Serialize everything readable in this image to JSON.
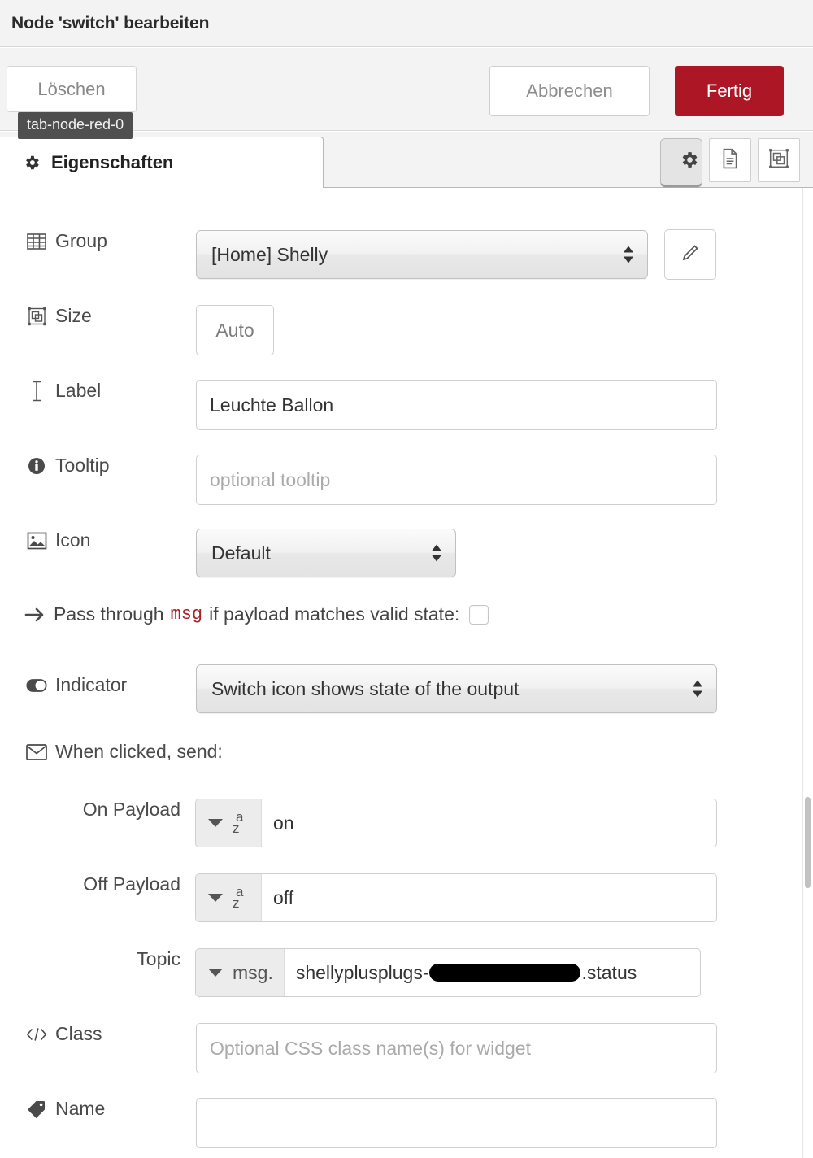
{
  "dialog": {
    "title": "Node 'switch' bearbeiten",
    "tooltip": "tab-node-red-0",
    "buttons": {
      "delete": "Löschen",
      "cancel": "Abbrechen",
      "done": "Fertig"
    },
    "accent_color": "#ad1625"
  },
  "tabs": {
    "active_label": "Eigenschaften",
    "icons": [
      {
        "name": "gear-icon",
        "selected": true
      },
      {
        "name": "document-icon",
        "selected": false
      },
      {
        "name": "appearance-icon",
        "selected": false
      }
    ]
  },
  "form": {
    "group": {
      "label": "Group",
      "icon": "table-icon",
      "value": "[Home] Shelly",
      "edit_button_icon": "pencil-icon"
    },
    "size": {
      "label": "Size",
      "icon": "object-group-icon",
      "value": "Auto"
    },
    "label_field": {
      "label": "Label",
      "icon": "text-cursor-icon",
      "value": "Leuchte Ballon"
    },
    "tooltip_field": {
      "label": "Tooltip",
      "icon": "info-circle-icon",
      "value": "",
      "placeholder": "optional tooltip"
    },
    "icon_field": {
      "label": "Icon",
      "icon": "image-icon",
      "value": "Default"
    },
    "passthrough": {
      "icon": "arrow-right-icon",
      "text_before": "Pass through",
      "code": "msg",
      "text_after": "if payload matches valid state:",
      "checked": false
    },
    "indicator": {
      "label": "Indicator",
      "icon": "toggle-on-icon",
      "value": "Switch icon shows state of the output"
    },
    "when_clicked": {
      "icon": "envelope-icon",
      "label": "When clicked, send:"
    },
    "on_payload": {
      "label": "On Payload",
      "type": "str",
      "type_glyph": "a z",
      "value": "on"
    },
    "off_payload": {
      "label": "Off Payload",
      "type": "str",
      "type_glyph": "a z",
      "value": "off"
    },
    "topic": {
      "label": "Topic",
      "type": "msg.",
      "value_prefix": "shellyplusplugs-",
      "value_redacted": true,
      "value_suffix": ".status"
    },
    "class_field": {
      "label": "Class",
      "icon": "code-icon",
      "value": "",
      "placeholder": "Optional CSS class name(s) for widget"
    },
    "name_field": {
      "label": "Name",
      "icon": "tag-icon",
      "value": "",
      "placeholder": ""
    }
  }
}
